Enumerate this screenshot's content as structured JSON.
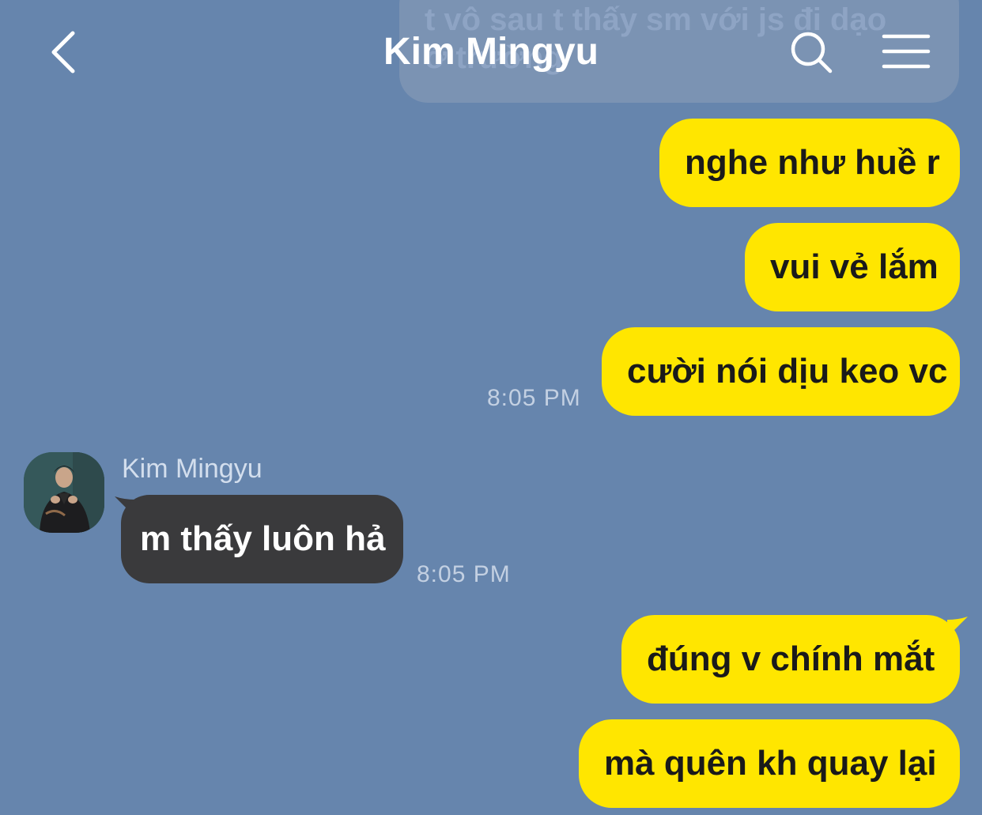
{
  "header": {
    "title": "Kim Mingyu",
    "back_icon": "chevron-left-icon",
    "search_icon": "search-icon",
    "menu_icon": "hamburger-menu-icon"
  },
  "faded_message": {
    "line1": "t vô sau t thấy sm với js đi dạo",
    "line2": "ở trường"
  },
  "messages": [
    {
      "text": "nghe như huề r",
      "side": "right"
    },
    {
      "text": "vui vẻ lắm",
      "side": "right"
    },
    {
      "text": "cười nói dịu keo vc",
      "side": "right",
      "time": "8:05 PM"
    },
    {
      "sender": "Kim Mingyu",
      "text": "m thấy luôn hả",
      "side": "left",
      "time": "8:05 PM"
    },
    {
      "text": "đúng v chính mắt",
      "side": "right"
    },
    {
      "text": "mà quên kh quay lại",
      "side": "right"
    }
  ],
  "colors": {
    "background": "#6685ad",
    "own_bubble": "#ffe600",
    "other_bubble": "#3a3a3c"
  }
}
